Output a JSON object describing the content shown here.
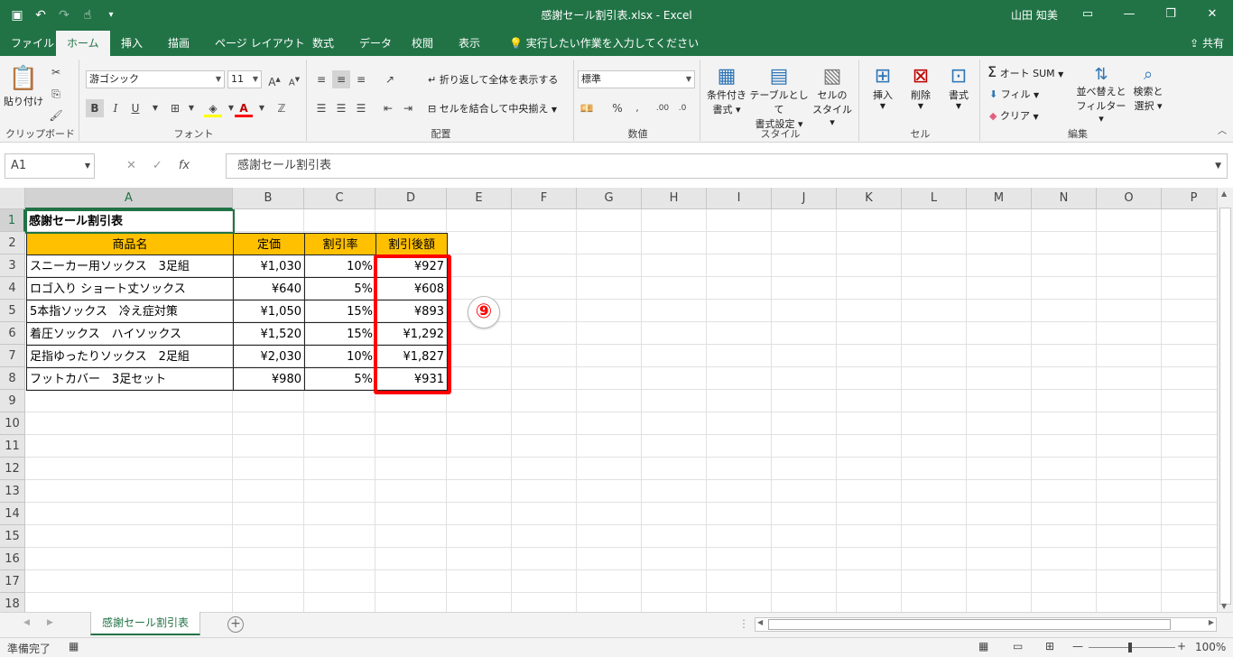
{
  "window": {
    "title": "感謝セール割引表.xlsx  -  Excel",
    "user": "山田 知美",
    "share": "共有"
  },
  "tabs": [
    {
      "label": "ファイル"
    },
    {
      "label": "ホーム"
    },
    {
      "label": "挿入"
    },
    {
      "label": "描画"
    },
    {
      "label": "ページ レイアウト"
    },
    {
      "label": "数式"
    },
    {
      "label": "データ"
    },
    {
      "label": "校閲"
    },
    {
      "label": "表示"
    }
  ],
  "tell_me": "実行したい作業を入力してください",
  "ribbon": {
    "clipboard": {
      "label": "クリップボード",
      "paste": "貼り付け"
    },
    "font": {
      "label": "フォント",
      "name": "游ゴシック",
      "size": "11",
      "bold": "B",
      "italic": "I",
      "underline": "U"
    },
    "alignment": {
      "label": "配置",
      "wrap": "折り返して全体を表示する",
      "merge": "セルを結合して中央揃え"
    },
    "number": {
      "label": "数値",
      "format": "標準"
    },
    "styles": {
      "label": "スタイル",
      "cond1": "条件付き",
      "cond2": "書式",
      "table1": "テーブルとして",
      "table2": "書式設定",
      "cell1": "セルの",
      "cell2": "スタイル"
    },
    "cells": {
      "label": "セル",
      "insert": "挿入",
      "delete": "削除",
      "format": "書式"
    },
    "editing": {
      "label": "編集",
      "autosum": "オート SUM",
      "fill": "フィル",
      "clear": "クリア",
      "sort1": "並べ替えと",
      "sort2": "フィルター",
      "find1": "検索と",
      "find2": "選択"
    }
  },
  "formula_bar": {
    "name_box": "A1",
    "content": "感謝セール割引表"
  },
  "columns": [
    "A",
    "B",
    "C",
    "D",
    "E",
    "F",
    "G",
    "H",
    "I",
    "J",
    "K",
    "L",
    "M",
    "N",
    "O",
    "P"
  ],
  "rows": [
    "1",
    "2",
    "3",
    "4",
    "5",
    "6",
    "7",
    "8",
    "9",
    "10",
    "11",
    "12",
    "13",
    "14",
    "15",
    "16",
    "17",
    "18"
  ],
  "sheet": {
    "title": "感謝セール割引表",
    "headers": [
      "商品名",
      "定価",
      "割引率",
      "割引後額"
    ],
    "data": [
      [
        "スニーカー用ソックス　3足組",
        "¥1,030",
        "10%",
        "¥927"
      ],
      [
        "ロゴ入り ショート丈ソックス",
        "¥640",
        "5%",
        "¥608"
      ],
      [
        "5本指ソックス　冷え症対策",
        "¥1,050",
        "15%",
        "¥893"
      ],
      [
        "着圧ソックス　ハイソックス",
        "¥1,520",
        "15%",
        "¥1,292"
      ],
      [
        "足指ゆったりソックス　2足組",
        "¥2,030",
        "10%",
        "¥1,827"
      ],
      [
        "フットカバー　3足セット",
        "¥980",
        "5%",
        "¥931"
      ]
    ]
  },
  "callout": "⑨",
  "sheet_tab": "感謝セール割引表",
  "status": {
    "ready": "準備完了",
    "zoom": "100%"
  },
  "colors": {
    "accent": "#217346",
    "header_fill": "#ffc000",
    "highlight": "#ff0000"
  }
}
